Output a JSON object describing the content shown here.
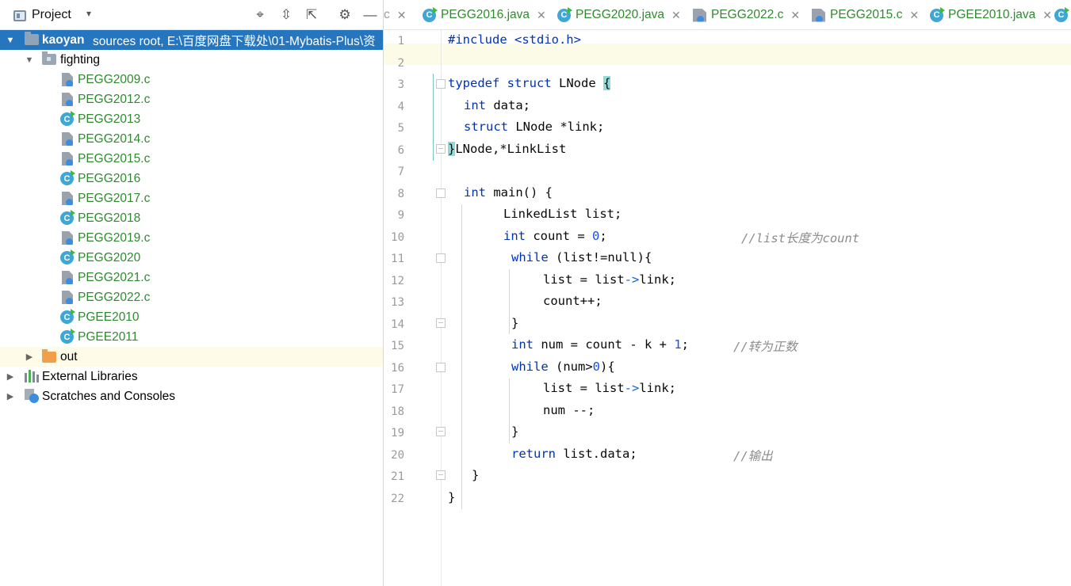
{
  "project_panel": {
    "title": "Project",
    "dropdown_glyph": "▾",
    "tools": [
      {
        "name": "locate-icon",
        "glyph": "⌖"
      },
      {
        "name": "expand-all-icon",
        "glyph": "⇳"
      },
      {
        "name": "collapse-all-icon",
        "glyph": "⇱"
      },
      {
        "name": "gear-icon",
        "glyph": "⚙"
      },
      {
        "name": "minimize-icon",
        "glyph": "—"
      }
    ],
    "root": {
      "name": "kaoyan",
      "detail": "sources root,  E:\\百度网盘下载处\\01-Mybatis-Plus\\资"
    },
    "folder": "fighting",
    "files": [
      {
        "name": "PEGG2009.c",
        "type": "c"
      },
      {
        "name": "PEGG2012.c",
        "type": "c"
      },
      {
        "name": "PEGG2013",
        "type": "java"
      },
      {
        "name": "PEGG2014.c",
        "type": "c"
      },
      {
        "name": "PEGG2015.c",
        "type": "c"
      },
      {
        "name": "PEGG2016",
        "type": "java"
      },
      {
        "name": "PEGG2017.c",
        "type": "c"
      },
      {
        "name": "PEGG2018",
        "type": "java"
      },
      {
        "name": "PEGG2019.c",
        "type": "c"
      },
      {
        "name": "PEGG2020",
        "type": "java"
      },
      {
        "name": "PEGG2021.c",
        "type": "c"
      },
      {
        "name": "PEGG2022.c",
        "type": "c"
      },
      {
        "name": "PGEE2010",
        "type": "java"
      },
      {
        "name": "PGEE2011",
        "type": "java"
      }
    ],
    "out_folder": "out",
    "external_libraries": "External Libraries",
    "scratches": "Scratches and Consoles"
  },
  "editor": {
    "tabs": [
      {
        "label": "c",
        "partial": true
      },
      {
        "label": "PEGG2016.java",
        "type": "java"
      },
      {
        "label": "PEGG2020.java",
        "type": "java"
      },
      {
        "label": "PEGG2022.c",
        "type": "c"
      },
      {
        "label": "PEGG2015.c",
        "type": "c"
      },
      {
        "label": "PGEE2010.java",
        "type": "java"
      }
    ],
    "close_glyph": "✕",
    "line_numbers": [
      "1",
      "2",
      "3",
      "4",
      "5",
      "6",
      "7",
      "8",
      "9",
      "10",
      "11",
      "12",
      "13",
      "14",
      "15",
      "16",
      "17",
      "18",
      "19",
      "20",
      "21",
      "22"
    ],
    "code": {
      "l1": "#include <stdio.h>",
      "l3a": "typedef struct",
      "l3b": " LNode ",
      "l3c": "{",
      "l4a": "int",
      "l4b": " data;",
      "l5a": "struct",
      "l5b": " LNode *link;",
      "l6a": "}",
      "l6b": "LNode,*LinkList",
      "l8a": "int",
      "l8b": " main() {",
      "l9": "LinkedList list;",
      "l10a": "int",
      "l10b": " count = ",
      "l10c": "0",
      "l10d": ";",
      "l10e": "//list长度为count",
      "l11a": "while",
      "l11b": " (list!=null){",
      "l12a": "list = list",
      "l12b": "->",
      "l12c": "link;",
      "l13": "count++;",
      "l14": "}",
      "l15a": "int",
      "l15b": " num = count - k + ",
      "l15c": "1",
      "l15d": ";",
      "l15e": "//转为正数",
      "l16a": "while",
      "l16b": " (num>",
      "l16c": "0",
      "l16d": "){",
      "l17a": "list = list",
      "l17b": "->",
      "l17c": "link;",
      "l18": "num --;",
      "l19": "}",
      "l20a": "return",
      "l20b": " list.data;",
      "l20c": "//输出",
      "l21": "}",
      "l22": "}"
    }
  }
}
